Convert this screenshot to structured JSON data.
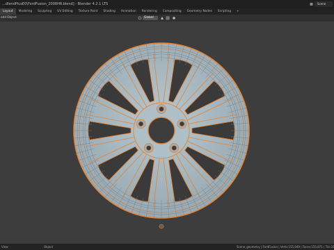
{
  "window": {
    "title": "...dlendPlusE0\\FordFusion_2008HR.blend] - Blender 4.2.1 LTS",
    "scene_label": "Scene"
  },
  "workspace_tabs": [
    {
      "label": "Layout",
      "active": true
    },
    {
      "label": "Modeling",
      "active": false
    },
    {
      "label": "Sculpting",
      "active": false
    },
    {
      "label": "UV Editing",
      "active": false
    },
    {
      "label": "Texture Paint",
      "active": false
    },
    {
      "label": "Shading",
      "active": false
    },
    {
      "label": "Animation",
      "active": false
    },
    {
      "label": "Rendering",
      "active": false
    },
    {
      "label": "Compositing",
      "active": false
    },
    {
      "label": "Geometry Nodes",
      "active": false
    },
    {
      "label": "Scripting",
      "active": false
    },
    {
      "label": "+",
      "active": false
    }
  ],
  "header": {
    "menu_edit": "edit",
    "menu_object": "Object",
    "orientation": "Global"
  },
  "status": {
    "left": "View",
    "middle": "Object",
    "right": "Scene_geometry | FordFusion | Verts:155,049 | Faces:155,871 | Tris:310,..."
  },
  "colors": {
    "viewport_bg": "#3d3d3d",
    "mesh_fill": "#a9bcc6",
    "wire": "#6f7a82",
    "selection": "#e8822e",
    "active_tab": "#3d3d3d"
  }
}
